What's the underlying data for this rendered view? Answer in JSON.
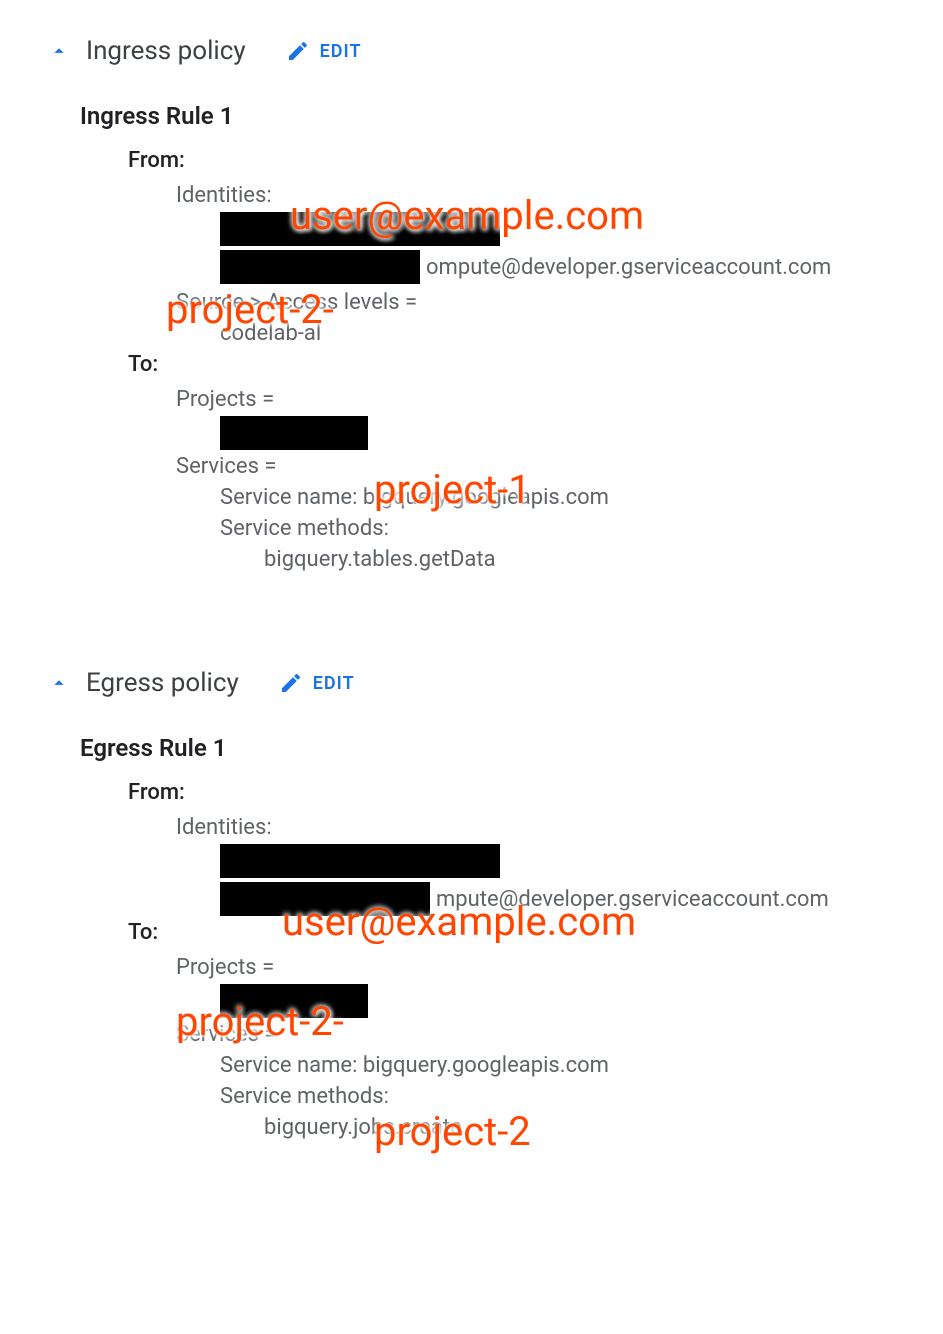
{
  "ingress": {
    "header_title": "Ingress policy",
    "edit_label": "EDIT",
    "rule_title": "Ingress Rule 1",
    "from_label": "From:",
    "identities_label": "Identities:",
    "identity_suffix": "ompute@developer.gserviceaccount.com",
    "source_line": "Source > Access levels =",
    "access_level_value": "codelab-al",
    "to_label": "To:",
    "projects_label": "Projects =",
    "services_label": "Services =",
    "service_name_line": "Service name: bigquery.googleapis.com",
    "service_methods_label": "Service methods:",
    "service_method_value": "bigquery.tables.getData"
  },
  "egress": {
    "header_title": "Egress policy",
    "edit_label": "EDIT",
    "rule_title": "Egress Rule 1",
    "from_label": "From:",
    "identities_label": "Identities:",
    "identity_suffix": "mpute@developer.gserviceaccount.com",
    "to_label": "To:",
    "projects_label": "Projects =",
    "services_label": "Services =",
    "service_name_line": "Service name: bigquery.googleapis.com",
    "service_methods_label": "Service methods:",
    "service_method_value": "bigquery.jobs.create"
  },
  "annotations": {
    "user_email_1": "user@example.com",
    "project_2_dash_1": "project-2-",
    "project_1": "project-1",
    "user_email_2": "user@example.com",
    "project_2_dash_2": "project-2-",
    "project_2": "project-2"
  }
}
